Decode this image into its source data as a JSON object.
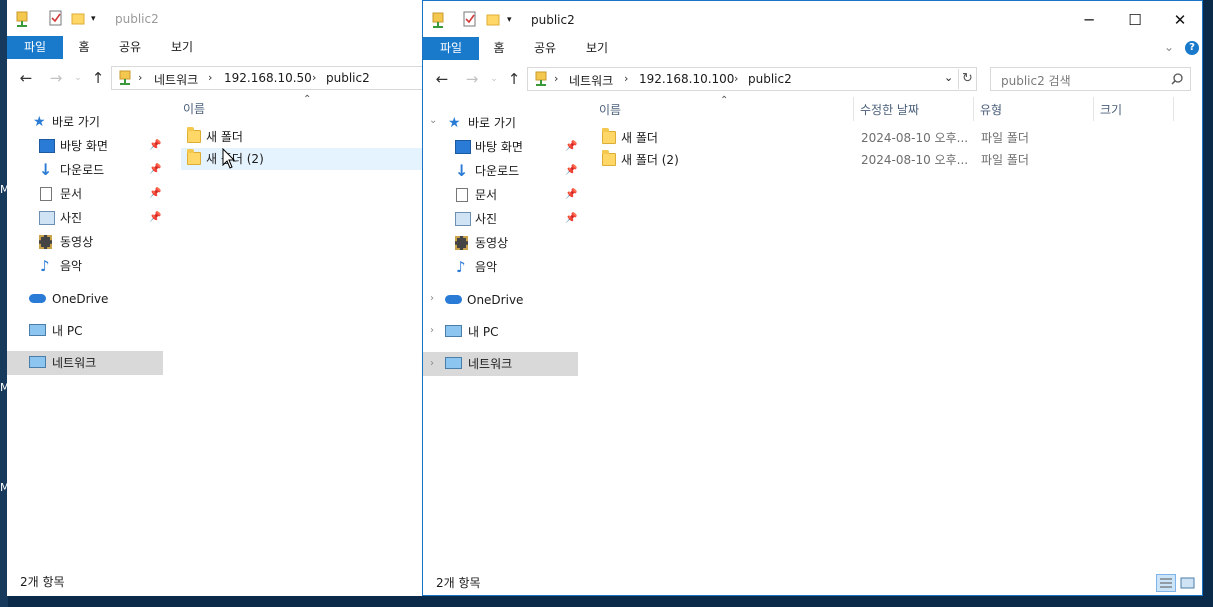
{
  "desktop": {
    "edge_letter": "M"
  },
  "left_window": {
    "title": "public2",
    "ribbon_tabs": [
      "파일",
      "홈",
      "공유",
      "보기"
    ],
    "address": [
      "네트워크",
      "192.168.10.50",
      "public2"
    ],
    "nav": {
      "quick_access": "바로 가기",
      "items": [
        "바탕 화면",
        "다운로드",
        "문서",
        "사진",
        "동영상",
        "음악"
      ],
      "onedrive": "OneDrive",
      "this_pc": "내 PC",
      "network": "네트워크"
    },
    "columns": {
      "name": "이름"
    },
    "files": [
      {
        "name": "새 폴더"
      },
      {
        "name": "새 폴더 (2)"
      }
    ],
    "status": "2개 항목"
  },
  "right_window": {
    "title": "public2",
    "ribbon_tabs": [
      "파일",
      "홈",
      "공유",
      "보기"
    ],
    "address": [
      "네트워크",
      "192.168.10.100",
      "public2"
    ],
    "search_placeholder": "public2 검색",
    "nav": {
      "quick_access": "바로 가기",
      "items": [
        "바탕 화면",
        "다운로드",
        "문서",
        "사진",
        "동영상",
        "음악"
      ],
      "onedrive": "OneDrive",
      "this_pc": "내 PC",
      "network": "네트워크"
    },
    "columns": {
      "name": "이름",
      "modified": "수정한 날짜",
      "type": "유형",
      "size": "크기"
    },
    "files": [
      {
        "name": "새 폴더",
        "modified": "2024-08-10 오후...",
        "type": "파일 폴더"
      },
      {
        "name": "새 폴더 (2)",
        "modified": "2024-08-10 오후...",
        "type": "파일 폴더"
      }
    ],
    "status": "2개 항목"
  },
  "colors": {
    "accent": "#1979ca",
    "selection": "#d9d9d9",
    "hover": "#e5f3ff"
  }
}
